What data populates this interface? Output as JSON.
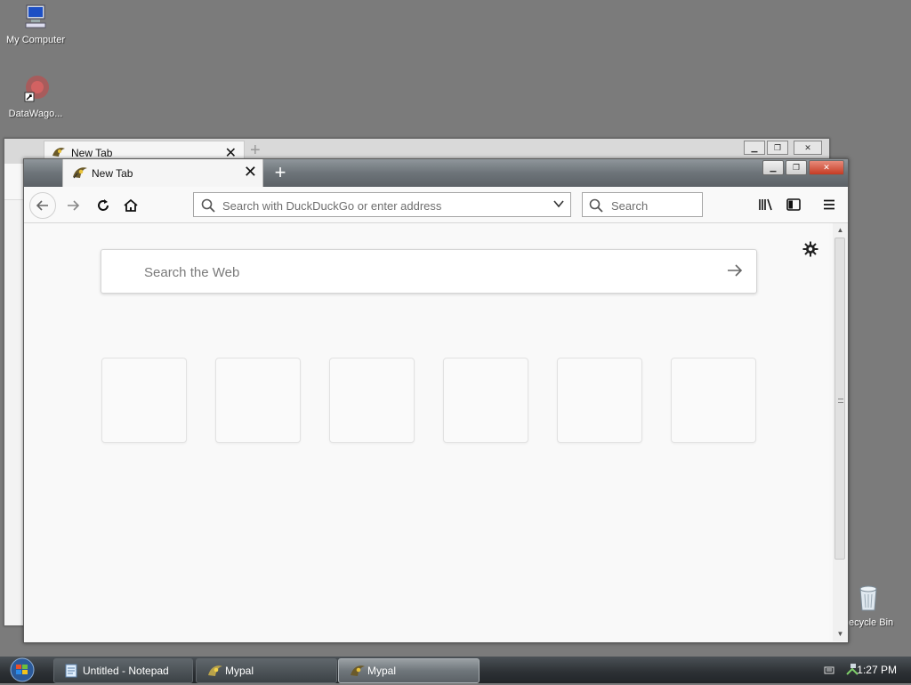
{
  "desktop": {
    "icons": [
      {
        "label": "My Computer",
        "icon": "computer-icon"
      },
      {
        "label": "DataWago...",
        "icon": "datawagon-shortcut-icon"
      },
      {
        "label": "ecycle Bin",
        "icon": "recycle-bin-icon"
      }
    ]
  },
  "background_window": {
    "tab_title": "New Tab",
    "tab_close": "✕",
    "new_tab": "+"
  },
  "browser": {
    "tab": {
      "title": "New Tab",
      "close": "✕"
    },
    "new_tab": "+",
    "window_controls": {
      "minimize": "▁",
      "restore": "❐",
      "close": "✕"
    },
    "urlbar": {
      "placeholder": "Search with DuckDuckGo or enter address",
      "value": ""
    },
    "searchbar": {
      "placeholder": "Search",
      "value": ""
    },
    "newtab_page": {
      "search_placeholder": "Search the Web",
      "tiles_count_label": ""
    }
  },
  "taskbar": {
    "items": [
      {
        "label": "Untitled - Notepad",
        "icon": "notepad-icon",
        "active": false
      },
      {
        "label": "Mypal",
        "icon": "mypal-icon",
        "active": false
      },
      {
        "label": "Mypal",
        "icon": "mypal-icon",
        "active": true
      }
    ],
    "clock": "1:27 PM"
  },
  "colors": {
    "desktop_bg": "#7b7b7b",
    "titlebar": "#6d7479",
    "close_button": "#c53b23",
    "taskbar": "#2c3034"
  }
}
